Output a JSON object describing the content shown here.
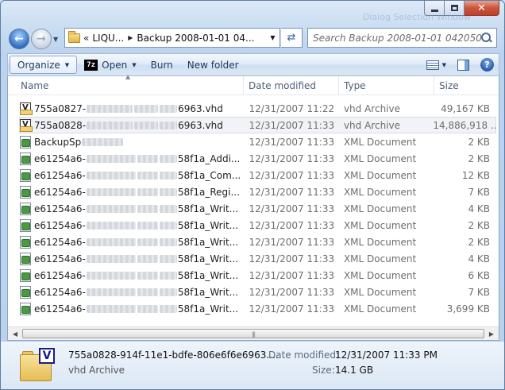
{
  "window": {
    "ghost_title": "Dialog Selection Window"
  },
  "caption": {
    "close_glyph": "✕"
  },
  "address": {
    "chevron": "«",
    "crumbs": [
      "LIQU...",
      "Backup 2008-01-01 04..."
    ]
  },
  "search": {
    "placeholder": "Search Backup 2008-01-01 042050"
  },
  "toolbar": {
    "organize": "Organize",
    "open": "Open",
    "open_icon_text": "7z",
    "burn": "Burn",
    "new_folder": "New folder",
    "help": "?"
  },
  "columns": {
    "name": "Name",
    "date": "Date modified",
    "type": "Type",
    "size": "Size"
  },
  "files": [
    {
      "prefix": "755a0827-",
      "suffix": "6963.vhd",
      "date": "12/31/2007 11:22 ...",
      "type": "vhd Archive",
      "size": "49,167 KB",
      "icon": "vhd-file-icon"
    },
    {
      "prefix": "755a0828-",
      "suffix": "6963.vhd",
      "date": "12/31/2007 11:33 ...",
      "type": "vhd Archive",
      "size": "14,886,918 ...",
      "icon": "vhd-file-icon"
    },
    {
      "prefix": "BackupSp",
      "suffix": "",
      "date": "12/31/2007 11:33 ...",
      "type": "XML Document",
      "size": "2 KB",
      "icon": "xml-file-icon"
    },
    {
      "prefix": "e61254a6-",
      "suffix": "58f1a_Addi...",
      "date": "12/31/2007 11:33 ...",
      "type": "XML Document",
      "size": "2 KB",
      "icon": "xml-file-icon"
    },
    {
      "prefix": "e61254a6-",
      "suffix": "58f1a_Com...",
      "date": "12/31/2007 11:33 ...",
      "type": "XML Document",
      "size": "12 KB",
      "icon": "xml-file-icon"
    },
    {
      "prefix": "e61254a6-",
      "suffix": "58f1a_Regi...",
      "date": "12/31/2007 11:33 ...",
      "type": "XML Document",
      "size": "7 KB",
      "icon": "xml-file-icon"
    },
    {
      "prefix": "e61254a6-",
      "suffix": "58f1a_Writ...",
      "date": "12/31/2007 11:33 ...",
      "type": "XML Document",
      "size": "4 KB",
      "icon": "xml-file-icon"
    },
    {
      "prefix": "e61254a6-",
      "suffix": "58f1a_Writ...",
      "date": "12/31/2007 11:33 ...",
      "type": "XML Document",
      "size": "2 KB",
      "icon": "xml-file-icon"
    },
    {
      "prefix": "e61254a6-",
      "suffix": "58f1a_Writ...",
      "date": "12/31/2007 11:33 ...",
      "type": "XML Document",
      "size": "2 KB",
      "icon": "xml-file-icon"
    },
    {
      "prefix": "e61254a6-",
      "suffix": "58f1a_Writ...",
      "date": "12/31/2007 11:33 ...",
      "type": "XML Document",
      "size": "4 KB",
      "icon": "xml-file-icon"
    },
    {
      "prefix": "e61254a6-",
      "suffix": "58f1a_Writ...",
      "date": "12/31/2007 11:33 ...",
      "type": "XML Document",
      "size": "6 KB",
      "icon": "xml-file-icon"
    },
    {
      "prefix": "e61254a6-",
      "suffix": "58f1a_Writ...",
      "date": "12/31/2007 11:33 ...",
      "type": "XML Document",
      "size": "7 KB",
      "icon": "xml-file-icon"
    },
    {
      "prefix": "e61254a6-",
      "suffix": "58f1a_Writ...",
      "date": "12/31/2007 11:33 ...",
      "type": "XML Document",
      "size": "3,699 KB",
      "icon": "xml-file-icon"
    }
  ],
  "selected_index": 1,
  "details": {
    "name": "755a0828-914f-11e1-bdfe-806e6f6e6963....",
    "type": "vhd Archive",
    "date_label": "Date modified:",
    "date_value": "12/31/2007 11:33 PM",
    "size_label": "Size:",
    "size_value": "14.1 GB",
    "icon_badge": "V"
  },
  "colors": {
    "accent": "#2f6cc2",
    "selection": "#f1f3f6"
  }
}
